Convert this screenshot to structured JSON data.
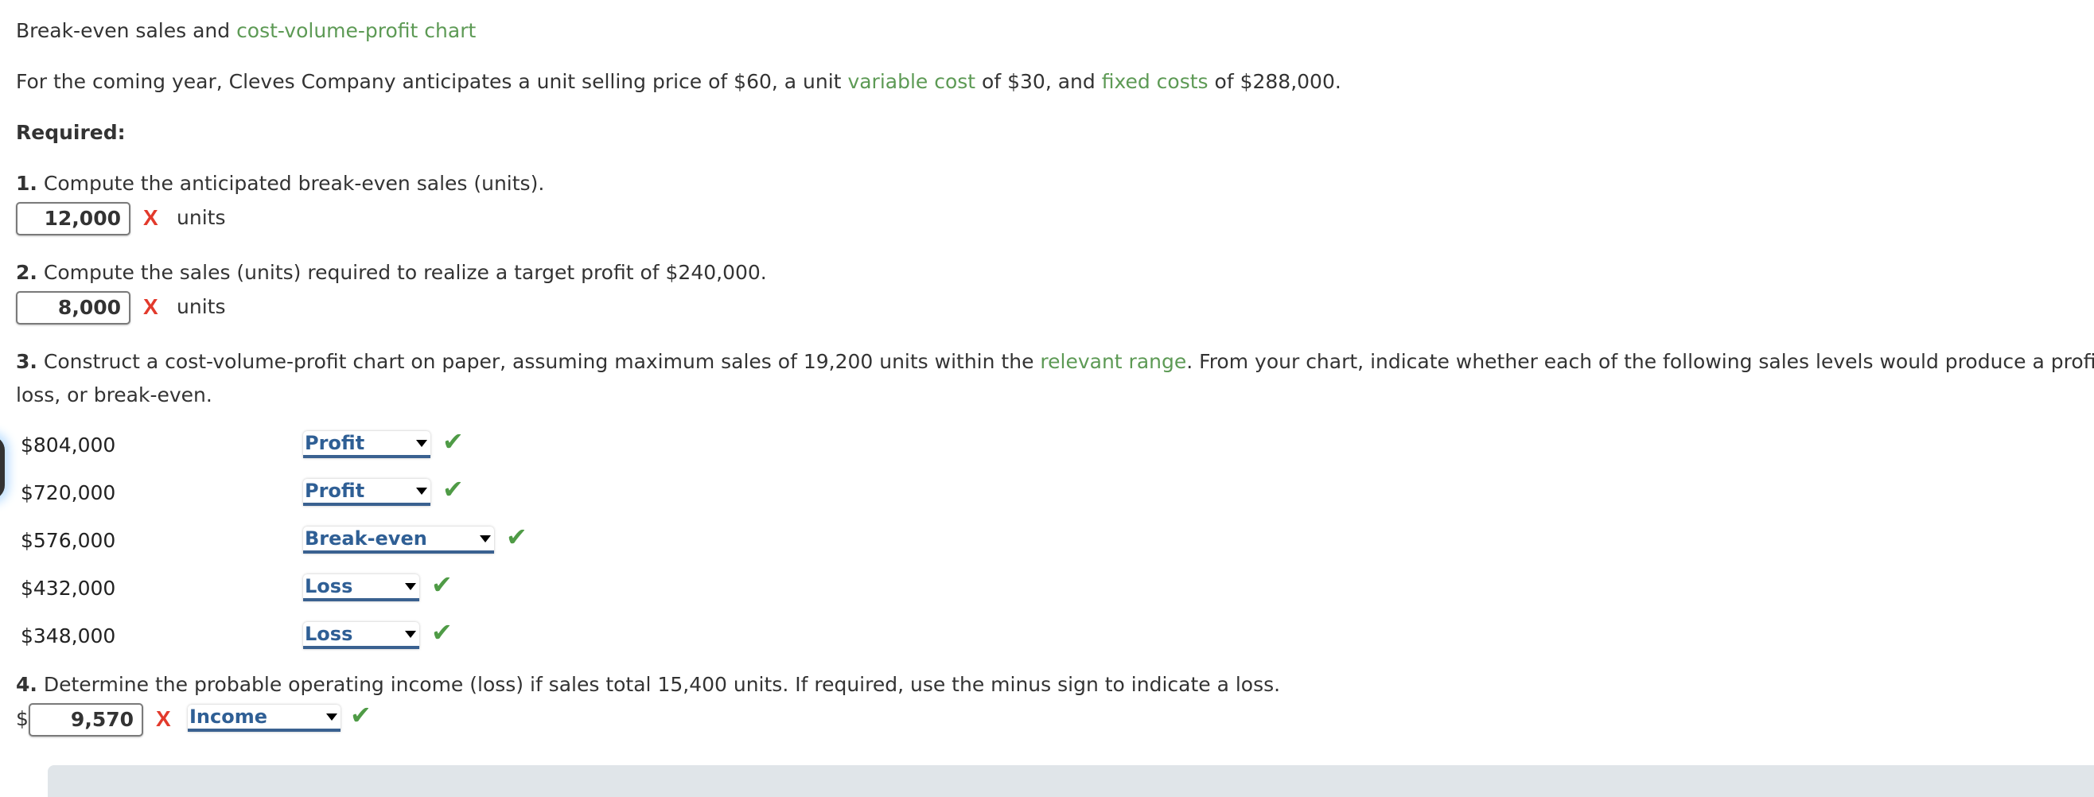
{
  "title": {
    "prefix": "Break-even sales and ",
    "link": "cost-volume-profit chart"
  },
  "intro": {
    "part1": "For the coming year, Cleves Company anticipates a unit selling price of $60, a unit ",
    "link1": "variable cost",
    "part2": " of $30, and ",
    "link2": "fixed costs",
    "part3": " of $288,000."
  },
  "required_label": "Required:",
  "q1": {
    "number": "1.",
    "text": "Compute the anticipated break-even sales (units).",
    "answer": "12,000",
    "status_icon": "incorrect-x-icon",
    "status_glyph": "X",
    "unit": "units"
  },
  "q2": {
    "number": "2.",
    "text": "Compute the sales (units) required to realize a target profit of $240,000.",
    "answer": "8,000",
    "status_glyph": "X",
    "unit": "units"
  },
  "q3": {
    "number": "3.",
    "text_part1": "Construct a cost-volume-profit chart on paper, assuming maximum sales of 19,200 units within the ",
    "link": "relevant range",
    "text_part2": ". From your chart, indicate whether each of the following sales levels would produce a profit, a",
    "text_line2": "loss, or break-even.",
    "rows": [
      {
        "amount": "$804,000",
        "selected": "Profit",
        "status_glyph": "✔"
      },
      {
        "amount": "$720,000",
        "selected": "Profit",
        "status_glyph": "✔"
      },
      {
        "amount": "$576,000",
        "selected": "Break-even",
        "status_glyph": "✔"
      },
      {
        "amount": "$432,000",
        "selected": "Loss",
        "status_glyph": "✔"
      },
      {
        "amount": "$348,000",
        "selected": "Loss",
        "status_glyph": "✔"
      }
    ]
  },
  "q4": {
    "number": "4.",
    "text": "Determine the probable operating income (loss) if sales total 15,400 units. If required, use the minus sign to indicate a loss.",
    "currency": "$",
    "answer": "9,570",
    "answer_status_glyph": "X",
    "selected": "Income",
    "select_status_glyph": "✔"
  },
  "colors": {
    "glossary_link": "#5d9a55",
    "incorrect": "#e23a2c",
    "correct": "#4f9b46",
    "select_text": "#2f5f95",
    "select_underline": "#3a6190"
  }
}
